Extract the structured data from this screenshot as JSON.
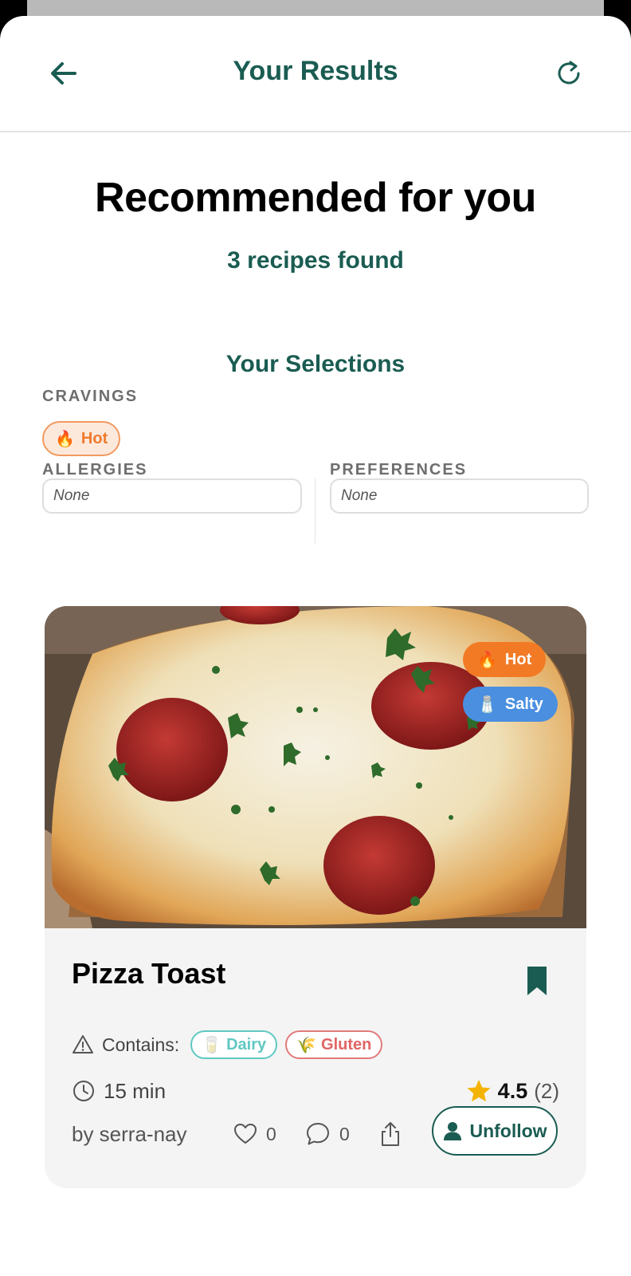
{
  "header": {
    "title": "Your Results",
    "back_icon": "arrow-left-icon",
    "refresh_icon": "refresh-icon"
  },
  "main": {
    "title": "Recommended for you",
    "subtitle": "3 recipes found"
  },
  "selections": {
    "title": "Your Selections",
    "cravings_label": "CRAVINGS",
    "cravings": [
      {
        "emoji": "🔥",
        "label": "Hot"
      }
    ],
    "allergies_label": "ALLERGIES",
    "allergies_value": "None",
    "preferences_label": "PREFERENCES",
    "preferences_value": "None"
  },
  "recipe": {
    "title": "Pizza Toast",
    "tags": [
      {
        "emoji": "🔥",
        "label": "Hot"
      },
      {
        "emoji": "🧂",
        "label": "Salty"
      }
    ],
    "contains_label": "Contains:",
    "allergens": [
      {
        "emoji": "🥛",
        "label": "Dairy"
      },
      {
        "emoji": "🌾",
        "label": "Gluten"
      }
    ],
    "time": "15 min",
    "rating": "4.5",
    "rating_count": "(2)",
    "author": "by serra-nay",
    "likes": "0",
    "comments": "0",
    "unfollow_label": "Unfollow"
  },
  "colors": {
    "primary": "#1a5c52",
    "hot": "#f37a25",
    "salty": "#4a8fe0",
    "dairy": "#5fc8c2",
    "gluten": "#e06565",
    "star": "#f5b301"
  }
}
